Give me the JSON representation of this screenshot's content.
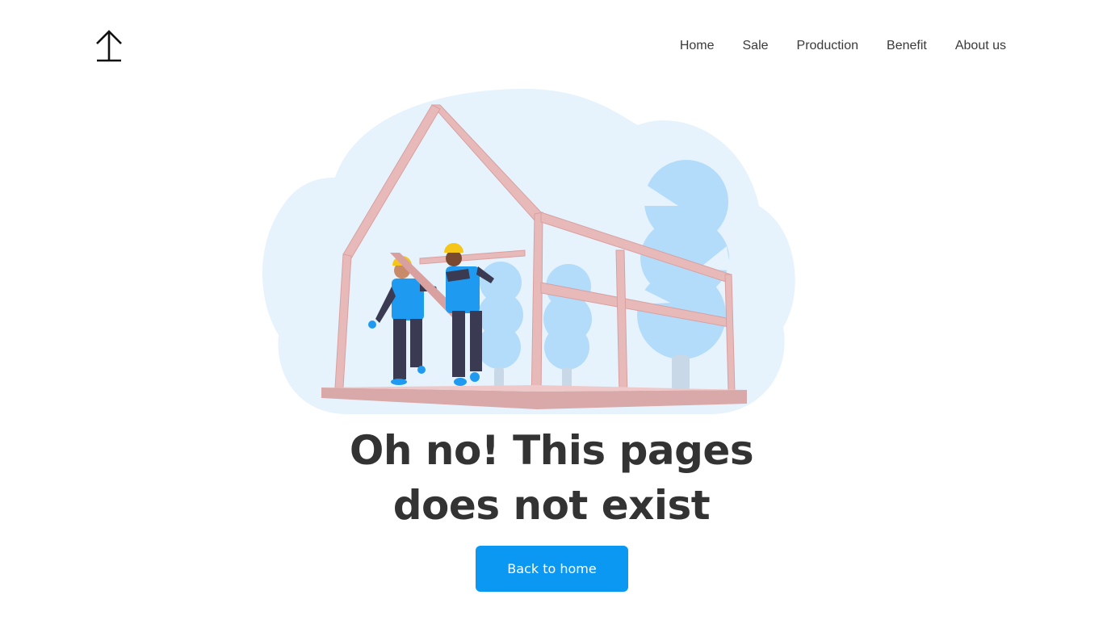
{
  "logo": {
    "icon": "up-arrow-logo-icon"
  },
  "nav": {
    "items": [
      {
        "label": "Home"
      },
      {
        "label": "Sale"
      },
      {
        "label": "Production"
      },
      {
        "label": "Benefit"
      },
      {
        "label": "About us"
      }
    ]
  },
  "illustration": {
    "icon": "construction-workers-house-frame-illustration"
  },
  "headline": {
    "line1": "Oh no! This pages",
    "line2": "does not exist"
  },
  "cta": {
    "label": "Back to home"
  },
  "colors": {
    "accent": "#0a98f2",
    "text": "#333333",
    "blob": "#e6f3fd",
    "tree": "#b3dcfa",
    "frame": "#e8b9b9",
    "vest": "#1e9bf0",
    "helmet": "#f5c518",
    "pants": "#3a3a52"
  }
}
